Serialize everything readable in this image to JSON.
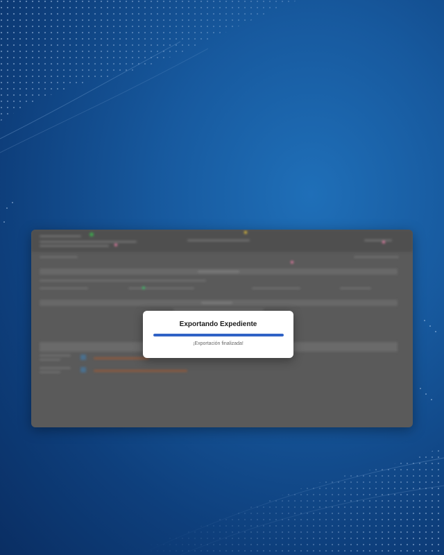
{
  "dialog": {
    "title": "Exportando Expediente",
    "status": "¡Exportación finalizada!",
    "progress_percent": 100
  },
  "colors": {
    "accent": "#2f62c6",
    "background": "#17599e",
    "overlay": "#5a5a5a"
  }
}
